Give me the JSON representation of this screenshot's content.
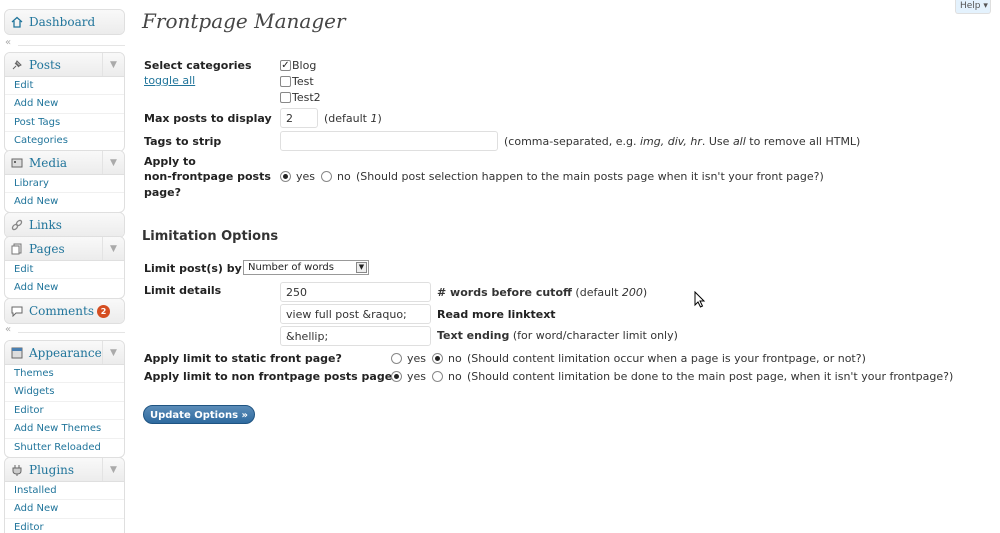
{
  "help": {
    "label": "Help ▾"
  },
  "sidebar": {
    "dashboard": "Dashboard",
    "posts": {
      "label": "Posts",
      "items": [
        "Edit",
        "Add New",
        "Post Tags",
        "Categories"
      ]
    },
    "media": {
      "label": "Media",
      "items": [
        "Library",
        "Add New"
      ]
    },
    "links": "Links",
    "pages": {
      "label": "Pages",
      "items": [
        "Edit",
        "Add New"
      ]
    },
    "comments": {
      "label": "Comments",
      "badge": "2"
    },
    "appearance": {
      "label": "Appearance",
      "items": [
        "Themes",
        "Widgets",
        "Editor",
        "Add New Themes",
        "Shutter Reloaded"
      ]
    },
    "plugins": {
      "label": "Plugins",
      "items": [
        "Installed",
        "Add New",
        "Editor"
      ]
    }
  },
  "page": {
    "title": "Frontpage Manager",
    "select_categories": "Select categories",
    "toggle_all": "toggle all",
    "categories": [
      {
        "name": "Blog",
        "checked": true
      },
      {
        "name": "Test",
        "checked": false
      },
      {
        "name": "Test2",
        "checked": false
      }
    ],
    "max_posts_label": "Max posts to display",
    "max_posts_value": "2",
    "max_posts_hint_a": "(default ",
    "max_posts_hint_b": "1",
    "max_posts_hint_c": ")",
    "tags_label": "Tags to strip",
    "tags_value": "",
    "tags_hint_a": "(comma-separated, e.g. ",
    "tags_hint_b": "img, div, hr",
    "tags_hint_c": ". Use ",
    "tags_hint_d": "all",
    "tags_hint_e": " to remove all HTML)",
    "apply_label_1": "Apply to",
    "apply_label_2": "non-frontpage posts",
    "apply_label_3": "page?",
    "yes": "yes",
    "no": "no",
    "apply_hint": "(Should post selection happen to the main posts page when it isn't your front page?)",
    "limitation_title": "Limitation Options",
    "limit_by_label": "Limit post(s) by",
    "limit_by_value": "Number of words",
    "limit_details_label": "Limit details",
    "words_value": "250",
    "words_label": "# words before cutoff",
    "words_hint_a": " (default ",
    "words_hint_b": "200",
    "words_hint_c": ")",
    "readmore_value": "view full post &raquo;",
    "readmore_label": "Read more linktext",
    "ending_value": "&hellip;",
    "ending_label": "Text ending",
    "ending_hint": " (for word/character limit only)",
    "static_label": "Apply limit to static front page?",
    "static_hint": "(Should content limitation occur when a page is your frontpage, or not?)",
    "nonfront_label": "Apply limit to non frontpage posts page?",
    "nonfront_hint": "(Should content limitation be done to the main post page, when it isn't your frontpage?)",
    "update_button": "Update Options »"
  }
}
